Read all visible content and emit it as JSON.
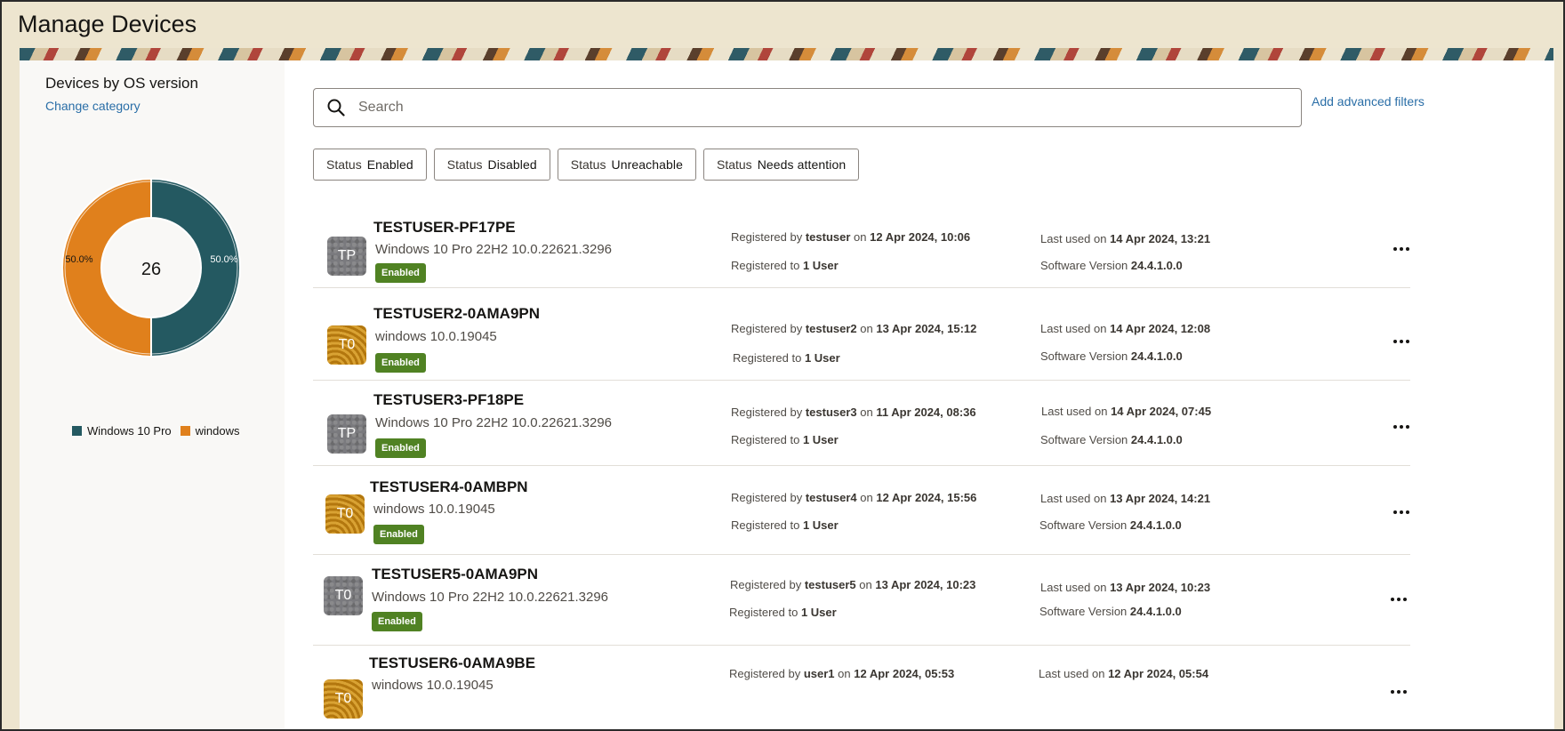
{
  "page": {
    "title": "Manage Devices"
  },
  "sidebar": {
    "title": "Devices by OS version",
    "change_category": "Change category",
    "donut": {
      "total": "26",
      "segments": [
        {
          "name": "Windows 10 Pro",
          "percent_label": "50.0%",
          "fraction": 0.5,
          "color": "#245961"
        },
        {
          "name": "windows",
          "percent_label": "50.0%",
          "fraction": 0.5,
          "color": "#e0801c"
        }
      ]
    },
    "legend": [
      {
        "label": "Windows 10 Pro",
        "color": "#245961"
      },
      {
        "label": "windows",
        "color": "#e0801c"
      }
    ]
  },
  "search": {
    "placeholder": "Search",
    "icon": "search-icon"
  },
  "advanced_filters": "Add advanced filters",
  "chips": [
    {
      "key": "Status",
      "value": "Enabled"
    },
    {
      "key": "Status",
      "value": "Disabled"
    },
    {
      "key": "Status",
      "value": "Unreachable"
    },
    {
      "key": "Status",
      "value": "Needs attention"
    }
  ],
  "devices": [
    {
      "initials": "TP",
      "avatar": "gray",
      "name": "TESTUSER-PF17PE",
      "os": "Windows 10 Pro 22H2 10.0.22621.3296",
      "status": "Enabled",
      "registered_by_label": "Registered by",
      "registered_by": "testuser",
      "on_label": "on",
      "registered_on": "12 Apr 2024, 10:06",
      "registered_to_label": "Registered to",
      "registered_to": "1 User",
      "last_used_label": "Last used on",
      "last_used": "14 Apr 2024, 13:21",
      "software_label": "Software Version",
      "software": "24.4.1.0.0"
    },
    {
      "initials": "T0",
      "avatar": "gold",
      "name": "TESTUSER2-0AMA9PN",
      "os": "windows 10.0.19045",
      "status": "Enabled",
      "registered_by_label": "Registered by",
      "registered_by": "testuser2",
      "on_label": "on",
      "registered_on": "13 Apr 2024, 15:12",
      "registered_to_label": "Registered to",
      "registered_to": "1 User",
      "last_used_label": "Last used on",
      "last_used": "14 Apr 2024, 12:08",
      "software_label": "Software Version",
      "software": "24.4.1.0.0"
    },
    {
      "initials": "TP",
      "avatar": "gray",
      "name": "TESTUSER3-PF18PE",
      "os": "Windows 10 Pro 22H2 10.0.22621.3296",
      "status": "Enabled",
      "registered_by_label": "Registered by",
      "registered_by": "testuser3",
      "on_label": "on",
      "registered_on": "11 Apr 2024, 08:36",
      "registered_to_label": "Registered to",
      "registered_to": "1 User",
      "last_used_label": "Last used on",
      "last_used": "14 Apr 2024, 07:45",
      "software_label": "Software Version",
      "software": "24.4.1.0.0"
    },
    {
      "initials": "T0",
      "avatar": "gold",
      "name": "TESTUSER4-0AMBPN",
      "os": "windows 10.0.19045",
      "status": "Enabled",
      "registered_by_label": "Registered by",
      "registered_by": "testuser4",
      "on_label": "on",
      "registered_on": "12 Apr 2024, 15:56",
      "registered_to_label": "Registered to",
      "registered_to": "1 User",
      "last_used_label": "Last used on",
      "last_used": "13 Apr 2024, 14:21",
      "software_label": "Software Version",
      "software": "24.4.1.0.0"
    },
    {
      "initials": "T0",
      "avatar": "gray",
      "name": "TESTUSER5-0AMA9PN",
      "os": "Windows 10 Pro 22H2 10.0.22621.3296",
      "status": "Enabled",
      "registered_by_label": "Registered by",
      "registered_by": "testuser5",
      "on_label": "on",
      "registered_on": "13 Apr 2024, 10:23",
      "registered_to_label": "Registered to",
      "registered_to": "1 User",
      "last_used_label": "Last used on",
      "last_used": "13 Apr 2024, 10:23",
      "software_label": "Software Version",
      "software": "24.4.1.0.0"
    },
    {
      "initials": "T0",
      "avatar": "gold",
      "name": "TESTUSER6-0AMA9BE",
      "os": "windows 10.0.19045",
      "status": "",
      "registered_by_label": "Registered by",
      "registered_by": "user1",
      "on_label": "on",
      "registered_on": "12 Apr 2024, 05:53",
      "registered_to_label": "",
      "registered_to": "",
      "last_used_label": "Last used on",
      "last_used": "12 Apr 2024, 05:54",
      "software_label": "",
      "software": ""
    }
  ]
}
